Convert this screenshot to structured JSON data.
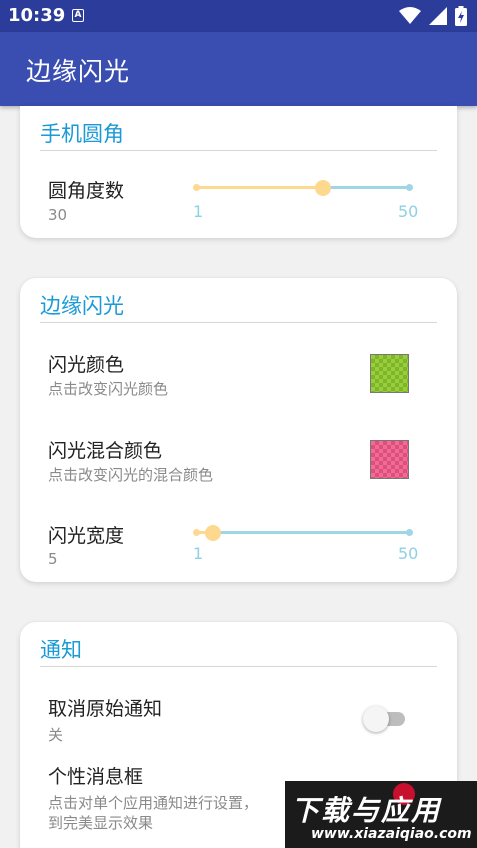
{
  "status_bar": {
    "time": "10:39",
    "badge": "A"
  },
  "app_bar": {
    "title": "边缘闪光"
  },
  "sections": {
    "corner": {
      "title": "手机圆角",
      "radius": {
        "label": "圆角度数",
        "value": "30",
        "min": "1",
        "max": "50",
        "current": 30
      }
    },
    "edge": {
      "title": "边缘闪光",
      "color": {
        "label": "闪光颜色",
        "desc": "点击改变闪光颜色",
        "swatch": "#98cd3c"
      },
      "mix_color": {
        "label": "闪光混合颜色",
        "desc": "点击改变闪光的混合颜色",
        "swatch": "#ef6c95"
      },
      "width": {
        "label": "闪光宽度",
        "value": "5",
        "min": "1",
        "max": "50",
        "current": 5
      }
    },
    "notify": {
      "title": "通知",
      "cancel_original": {
        "label": "取消原始通知",
        "state": "关",
        "on": false
      },
      "custom_box": {
        "label": "个性消息框",
        "desc_line1": "点击对单个应用通知进行设置，",
        "desc_line2": "到完美显示效果"
      }
    }
  },
  "watermark": {
    "name": "下载与应用",
    "url": "www.xiazaiqiao.com"
  },
  "colors": {
    "primary": "#3a4db0",
    "status": "#2c3c9a",
    "accent": "#1a9ad6",
    "slider_fill": "#fcd98e",
    "slider_track": "#9ed6e6"
  }
}
